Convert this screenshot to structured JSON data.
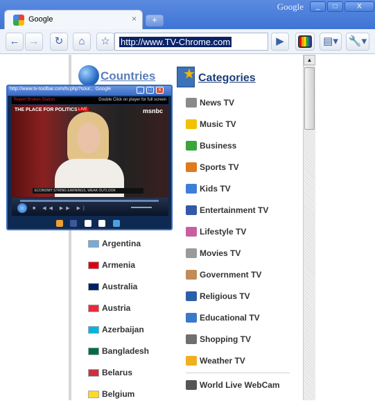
{
  "browser": {
    "brand": "Google",
    "tab_title": "Google",
    "url": "http://www.TV-Chrome.com",
    "window_buttons": [
      "_",
      "□",
      "X"
    ]
  },
  "page": {
    "countries_heading": "Countries",
    "categories_heading": "Categories",
    "categories": [
      {
        "label": "News TV",
        "icon": "news-icon",
        "color": "#8a8a8a"
      },
      {
        "label": "Music TV",
        "icon": "music-icon",
        "color": "#f2c200"
      },
      {
        "label": "Business",
        "icon": "money-icon",
        "color": "#3aa53a"
      },
      {
        "label": "Sports TV",
        "icon": "ball-icon",
        "color": "#e07a1f"
      },
      {
        "label": "Kids TV",
        "icon": "blocks-icon",
        "color": "#3d7fd8"
      },
      {
        "label": "Entertainment TV",
        "icon": "entertainment-icon",
        "color": "#3458a8"
      },
      {
        "label": "Lifestyle TV",
        "icon": "lifestyle-icon",
        "color": "#c95fa0"
      },
      {
        "label": "Movies TV",
        "icon": "film-icon",
        "color": "#9a9a9a"
      },
      {
        "label": "Government TV",
        "icon": "government-icon",
        "color": "#c28b5a"
      },
      {
        "label": "Religious TV",
        "icon": "book-icon",
        "color": "#2b5fa8"
      },
      {
        "label": "Educational TV",
        "icon": "education-icon",
        "color": "#3b78c8"
      },
      {
        "label": "Shopping TV",
        "icon": "cart-icon",
        "color": "#6f6f6f"
      },
      {
        "label": "Weather TV",
        "icon": "weather-icon",
        "color": "#f0b020"
      },
      {
        "label": "World Live WebCam",
        "icon": "webcam-icon",
        "color": "#555555"
      }
    ],
    "countries": [
      {
        "label": "Argentina",
        "flag": "flag-argentina-icon",
        "color": "#75aadb"
      },
      {
        "label": "Armenia",
        "flag": "flag-armenia-icon",
        "color": "#d90012"
      },
      {
        "label": "Australia",
        "flag": "flag-australia-icon",
        "color": "#012169"
      },
      {
        "label": "Austria",
        "flag": "flag-austria-icon",
        "color": "#ed2939"
      },
      {
        "label": "Azerbaijan",
        "flag": "flag-azerbaijan-icon",
        "color": "#00b5e2"
      },
      {
        "label": "Bangladesh",
        "flag": "flag-bangladesh-icon",
        "color": "#006a4e"
      },
      {
        "label": "Belarus",
        "flag": "flag-belarus-icon",
        "color": "#c8313e"
      },
      {
        "label": "Belgium",
        "flag": "flag-belgium-icon",
        "color": "#fdda24"
      }
    ]
  },
  "player": {
    "title": "http://www.tv-toolbar.com/tv.php?sour...  Google",
    "report": "Report Broken Station",
    "hint": "Double Click on player for full screen",
    "show_logo": "THE PLACE FOR POLITICS",
    "live": "LIVE",
    "network": "msnbc",
    "ticker": "ECONOMY   STRING EARNINGS, WEAK OUTLOOK"
  }
}
